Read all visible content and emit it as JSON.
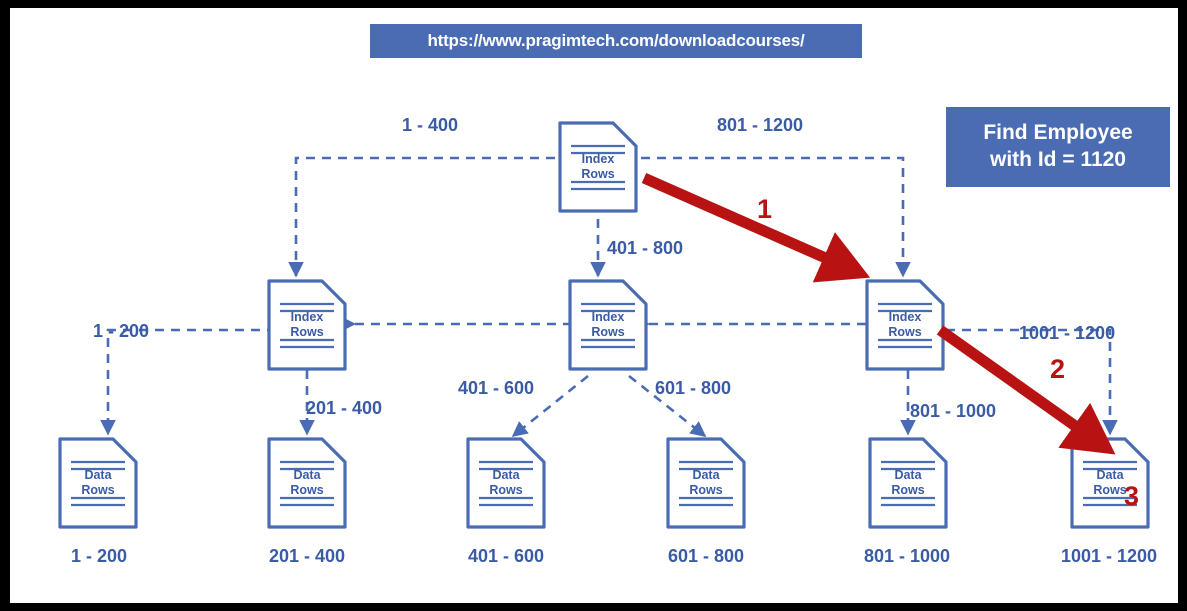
{
  "banner": {
    "url": "https://www.pragimtech.com/downloadcourses/"
  },
  "legend": {
    "line1": "Find Employee",
    "line2": "with Id = 1120"
  },
  "nodes": {
    "index_label_line1": "Index",
    "index_label_line2": "Rows",
    "data_label_line1": "Data",
    "data_label_line2": "Rows",
    "root": {
      "name": "root-index-node"
    },
    "level2": [
      {
        "name": "index-node-left"
      },
      {
        "name": "index-node-middle"
      },
      {
        "name": "index-node-right"
      }
    ],
    "leaves": [
      {
        "name": "data-node-1-200"
      },
      {
        "name": "data-node-201-400"
      },
      {
        "name": "data-node-401-600"
      },
      {
        "name": "data-node-601-800"
      },
      {
        "name": "data-node-801-1000"
      },
      {
        "name": "data-node-1001-1200"
      }
    ]
  },
  "edge_labels": {
    "root_left": "1 - 400",
    "root_middle": "401 - 800",
    "root_right": "801 - 1200",
    "left_first": "1 - 200",
    "left_second": "201 - 400",
    "mid_first": "401 - 600",
    "mid_second": "601 - 800",
    "right_first": "801 - 1000",
    "right_second": "1001 - 1200"
  },
  "bottom_labels": [
    "1 - 200",
    "201 - 400",
    "401 - 600",
    "601 - 800",
    "801 - 1000",
    "1001 - 1200"
  ],
  "steps": [
    {
      "label": "1"
    },
    {
      "label": "2"
    },
    {
      "label": "3"
    }
  ],
  "colors": {
    "accent_blue": "#4a6cb3",
    "text_blue": "#3a5ba6",
    "node_stroke": "#4a6cb3",
    "red": "#b81212",
    "banner_bg": "#4a6cb3",
    "page_bg": "#ffffff",
    "frame": "#000000"
  }
}
